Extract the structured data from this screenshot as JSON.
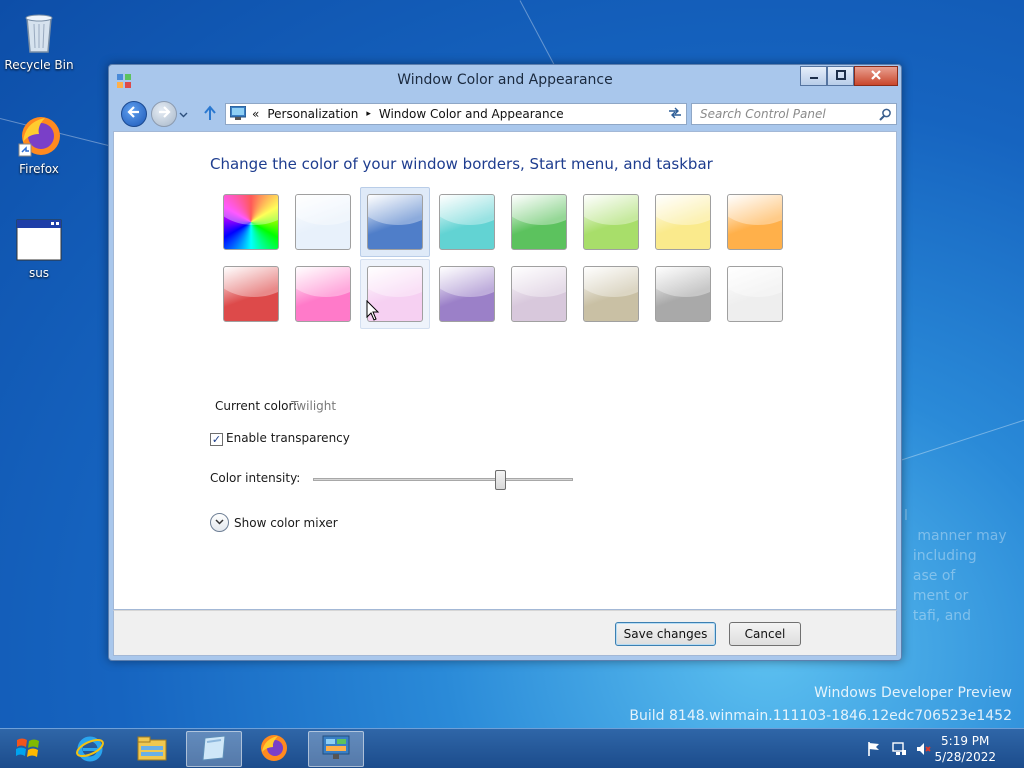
{
  "desktop": {
    "icons": [
      {
        "label": "Recycle Bin",
        "icon": "recycle-bin-icon"
      },
      {
        "label": "Firefox",
        "icon": "firefox-icon"
      },
      {
        "label": "sus",
        "icon": "window-app-icon"
      }
    ],
    "watermark_line1": "Windows Developer Preview",
    "watermark_line2": "Build 8148.winmain.111103-1846.12edc706523e1452",
    "ghost_text": "l\n   manner may\n  including\n  ase of\n  ment or\n  tafi, and"
  },
  "window": {
    "title": "Window Color and Appearance",
    "controls": {
      "minimize": "minimize-icon",
      "maximize": "maximize-icon",
      "close": "close-icon"
    },
    "address": {
      "prefix": "«",
      "crumbs": [
        "Personalization",
        "Window Color and Appearance"
      ],
      "separator": "▸"
    },
    "search_placeholder": "Search Control Panel",
    "heading": "Change the color of your window borders, Start menu, and taskbar",
    "swatches_row1": [
      {
        "name": "rainbow",
        "color": "#ff0000"
      },
      {
        "name": "sky",
        "color": "#e8f1fb"
      },
      {
        "name": "twilight",
        "color": "#4f7ec9"
      },
      {
        "name": "sea-foam",
        "color": "#62d3d3"
      },
      {
        "name": "leaf",
        "color": "#5cc25e"
      },
      {
        "name": "lime",
        "color": "#a8de6a"
      },
      {
        "name": "lemon",
        "color": "#faea8c"
      },
      {
        "name": "pumpkin",
        "color": "#ffb04a"
      }
    ],
    "swatches_row2": [
      {
        "name": "ruby",
        "color": "#dd4a4a"
      },
      {
        "name": "fuchsia",
        "color": "#ff7ac9"
      },
      {
        "name": "blush",
        "color": "#f6d0f2"
      },
      {
        "name": "violet",
        "color": "#9b80c8"
      },
      {
        "name": "lavender",
        "color": "#d8c8dc"
      },
      {
        "name": "taupe",
        "color": "#c9c0a4"
      },
      {
        "name": "chocolate",
        "color": "#a9a9a9"
      },
      {
        "name": "frost",
        "color": "#eeeeee"
      }
    ],
    "current_color_label": "Current color:",
    "current_color_value": "Twilight",
    "transparency_label": "Enable transparency",
    "transparency_checked": true,
    "intensity_label": "Color intensity:",
    "intensity_value": 0.72,
    "color_mixer_label": "Show color mixer",
    "save_label": "Save changes",
    "cancel_label": "Cancel"
  },
  "taskbar": {
    "items": [
      "start-orb-icon",
      "internet-explorer-icon",
      "file-explorer-icon",
      "window-app-icon",
      "firefox-icon",
      "control-panel-icon"
    ],
    "time": "5:19 PM",
    "date": "5/28/2022"
  }
}
